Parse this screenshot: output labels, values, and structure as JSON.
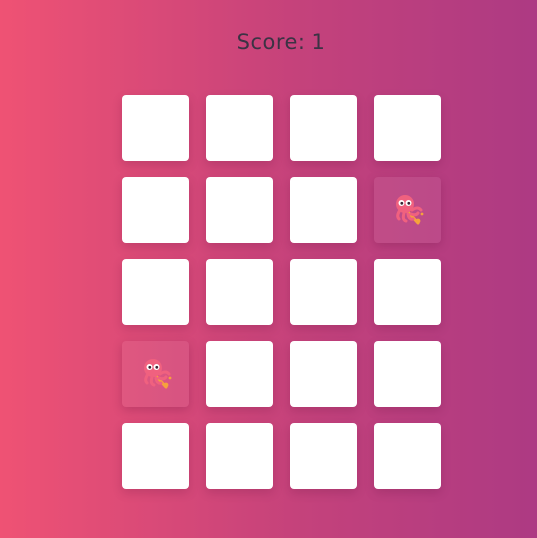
{
  "header": {
    "score_label": "Score:",
    "score_value": "1"
  },
  "board": {
    "rows": 5,
    "cols": 4,
    "matched_icon": "octopus-icon",
    "matched_positions": [
      [
        1,
        3
      ],
      [
        3,
        0
      ]
    ]
  },
  "colors": {
    "card_face": "#ffffff",
    "octopus_body": "#f0617f",
    "octopus_accent": "#f6a23c"
  }
}
